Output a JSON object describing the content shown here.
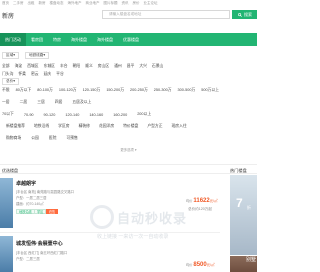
{
  "topbar": {
    "items": [
      "首页",
      "二手房",
      "出租",
      "新房",
      "楼盘动态",
      "海外地产",
      "商业地产",
      "图片标题",
      "资讯",
      "房价",
      "业主论坛"
    ]
  },
  "header": {
    "title": "新房",
    "search_placeholder": "请输入楼盘名或地址",
    "search_button": "搜索"
  },
  "nav": {
    "items": [
      "热门活动",
      "看房团",
      "特房",
      "海外楼盘",
      "海外楼盘",
      "优惠楼盘"
    ]
  },
  "filters": {
    "region_dropdown": "区域",
    "subway_dropdown": "地铁线路",
    "districts": [
      "全部",
      "海淀",
      "西城区",
      "东城区",
      "丰台",
      "朝阳",
      "顺义",
      "房山区",
      "通州",
      "昌平",
      "大兴",
      "石景山",
      "门头沟",
      "怀柔",
      "密云",
      "延庆",
      "平谷"
    ],
    "price_dropdown": "总价",
    "prices": [
      "不限",
      "80万以下",
      "80-100万",
      "100-120万",
      "120-150万",
      "150-200万",
      "200-250万",
      "250-300万",
      "300-500万",
      "500万以上"
    ],
    "rooms": [
      "一居",
      "二居",
      "三居",
      "四居",
      "五居及以上"
    ],
    "areas": [
      "70以下",
      "70-90",
      "90-120",
      "120-140",
      "140-160",
      "160-200",
      "200以上"
    ],
    "features": [
      "新楼盘推荐",
      "地铁沿线",
      "学区房",
      "精装修",
      "花园洋房",
      "特价楼盘",
      "户型方正",
      "现房入住"
    ],
    "more": [
      "购物商场",
      "公园",
      "医院",
      "可预售"
    ],
    "expand": "更多选项"
  },
  "section": {
    "title": "优选楼盘",
    "hot_title": "热门楼盘"
  },
  "listings": [
    {
      "name": "卓越朗宇",
      "line1": "[丰台区 南苑] 南苑路与嘉园路交叉路口",
      "line2": "户型：一居二居三居",
      "line3": "建面：约70-140㎡",
      "tags": [
        "地铁沿线",
        "学区",
        "在售"
      ],
      "price_prefix": "均价",
      "price": "11622",
      "price_unit": "元/㎡",
      "total": "总价约120万起"
    },
    {
      "name": "城发恒伟·会展壹中心",
      "line1": "[丰台区 西红门] 南五环西红门路口",
      "line2": "户型：二居三居",
      "line3": "",
      "tags": [],
      "price_prefix": "均价",
      "price": "8500",
      "price_unit": "元/㎡",
      "total": ""
    }
  ],
  "ads": {
    "ad1_big": "7",
    "ad1_small": "折",
    "ad2_text": "别墅"
  },
  "watermark": {
    "title": "自动秒收录",
    "subtitle": "收上链接 一来访一次一自动收录"
  },
  "colors": {
    "brand": "#22b573",
    "price": "#f05a28"
  }
}
